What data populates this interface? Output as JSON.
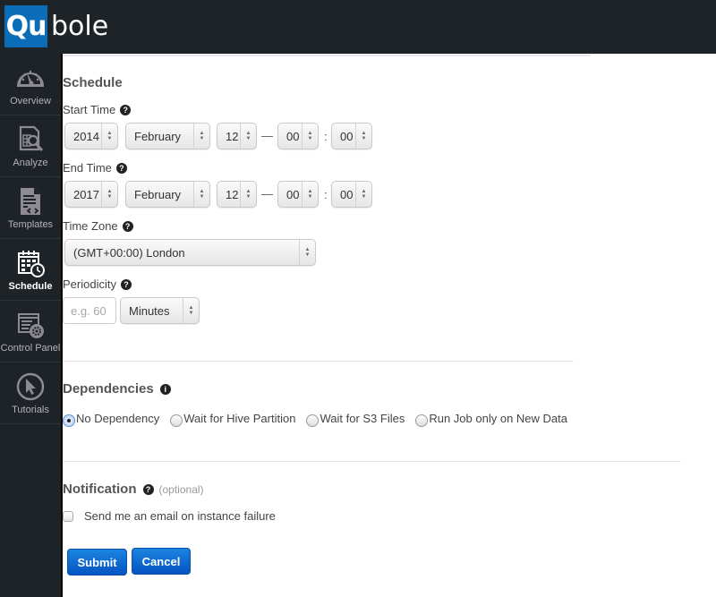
{
  "app": {
    "logo_box": "Qu",
    "logo_rest": "bole",
    "brand_color": "#0b6cb8"
  },
  "sidebar": {
    "items": [
      {
        "label": "Overview",
        "icon": "dashboard-gauge-icon",
        "active": false
      },
      {
        "label": "Analyze",
        "icon": "analyze-magnifier-icon",
        "active": false
      },
      {
        "label": "Templates",
        "icon": "template-document-icon",
        "active": false
      },
      {
        "label": "Schedule",
        "icon": "calendar-clock-icon",
        "active": true
      },
      {
        "label": "Control Panel",
        "icon": "control-panel-gear-icon",
        "active": false
      },
      {
        "label": "Tutorials",
        "icon": "cursor-pointer-icon",
        "active": false
      }
    ]
  },
  "schedule": {
    "title": "Schedule",
    "start_time": {
      "label": "Start Time",
      "year": "2014",
      "month": "February",
      "day": "12",
      "hour": "00",
      "minute": "00"
    },
    "end_time": {
      "label": "End Time",
      "year": "2017",
      "month": "February",
      "day": "12",
      "hour": "00",
      "minute": "00"
    },
    "date_time_separator": "—",
    "time_separator": ":",
    "time_zone": {
      "label": "Time Zone",
      "value": "(GMT+00:00) London"
    },
    "periodicity": {
      "label": "Periodicity",
      "placeholder": "e.g. 60",
      "value": "",
      "unit": "Minutes"
    },
    "help_glyph": "?"
  },
  "dependencies": {
    "title": "Dependencies",
    "info_glyph": "i",
    "options": [
      {
        "label": "No Dependency",
        "checked": true
      },
      {
        "label": "Wait for Hive Partition",
        "checked": false
      },
      {
        "label": "Wait for S3 Files",
        "checked": false
      },
      {
        "label": "Run Job only on New Data",
        "checked": false
      }
    ]
  },
  "notification": {
    "title": "Notification",
    "optional_note": "(optional)",
    "email_checkbox_label": "Send me an email on instance failure",
    "email_checked": false
  },
  "actions": {
    "submit_label": "Submit",
    "cancel_label": "Cancel"
  }
}
